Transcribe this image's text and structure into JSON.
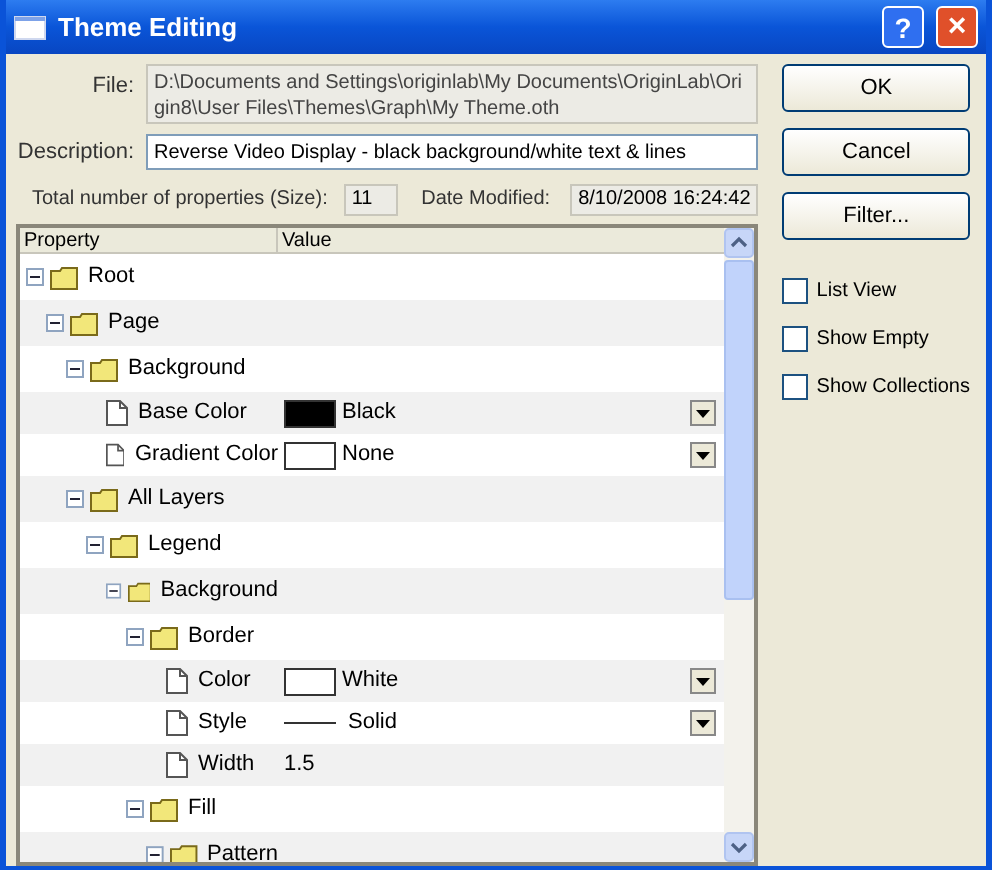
{
  "window": {
    "title": "Theme Editing",
    "buttons": [
      "?",
      "×"
    ]
  },
  "file": {
    "label": "File:",
    "value": "D:\\Documents and Settings\\originlab\\My Documents\\OriginLab\\Origin8\\User Files\\Themes\\Graph\\My Theme.oth"
  },
  "description": {
    "label": "Description:",
    "value": "Reverse Video Display - black background/white text & lines"
  },
  "size": {
    "label": "Total number of properties (Size):",
    "value": "11"
  },
  "date_modified": {
    "label": "Date Modified:",
    "value": "8/10/2008 16:24:42"
  },
  "table": {
    "columns": [
      "Property",
      "Value"
    ],
    "tree": [
      {
        "name": "Root",
        "expanded": true,
        "children": [
          {
            "name": "Page",
            "expanded": true,
            "children": [
              {
                "name": "Background",
                "expanded": true,
                "children": [
                  {
                    "name": "Base Color",
                    "kind": "color",
                    "color": "#000000",
                    "value": "Black"
                  },
                  {
                    "name": "Gradient Color",
                    "kind": "color",
                    "color": "#ffffff",
                    "value": "None"
                  }
                ]
              },
              {
                "name": "All Layers",
                "expanded": true,
                "children": [
                  {
                    "name": "Legend",
                    "expanded": true,
                    "children": [
                      {
                        "name": "Background",
                        "expanded": true,
                        "children": [
                          {
                            "name": "Border",
                            "expanded": true,
                            "children": [
                              {
                                "name": "Color",
                                "kind": "color",
                                "color": "#ffffff",
                                "value": "White"
                              },
                              {
                                "name": "Style",
                                "kind": "line",
                                "value": "Solid"
                              },
                              {
                                "name": "Width",
                                "kind": "text",
                                "value": "1.5"
                              }
                            ]
                          },
                          {
                            "name": "Fill",
                            "expanded": true,
                            "children": [
                              {
                                "name": "Pattern",
                                "expanded": true
                              }
                            ]
                          }
                        ]
                      }
                    ]
                  }
                ]
              }
            ]
          }
        ]
      }
    ]
  },
  "buttons": [
    "OK",
    "Cancel",
    "Filter..."
  ],
  "options": [
    {
      "label": "List View",
      "checked": false
    },
    {
      "label": "Show Empty",
      "checked": false
    },
    {
      "label": "Show Collections",
      "checked": false
    }
  ]
}
